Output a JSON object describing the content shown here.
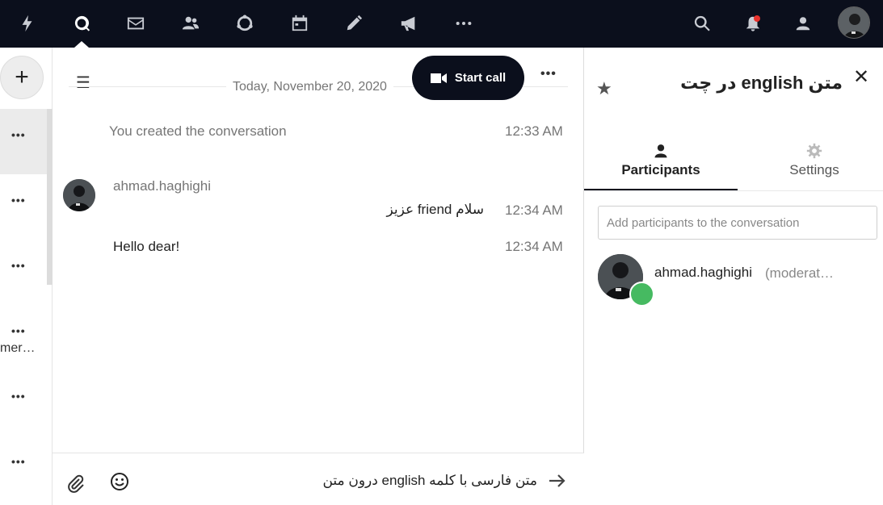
{
  "nav": {
    "icons": [
      "dashboard-icon",
      "talk-icon",
      "mail-icon",
      "contacts-icon",
      "circles-icon",
      "calendar-icon",
      "notes-icon",
      "announcements-icon",
      "more-apps-icon",
      "search-icon",
      "notifications-icon",
      "contacts-menu-icon",
      "user-avatar"
    ],
    "active": "talk-icon",
    "colors": {
      "bar": "#0b0f1c",
      "notification_dot": "#e9322d"
    }
  },
  "left": {
    "new_button_label": "+",
    "more_label": "•••",
    "truncated_item_text": "mer…"
  },
  "chat": {
    "date_separator": "Today, November 20, 2020",
    "start_call_label": "Start call",
    "more_label": "•••",
    "messages": [
      {
        "type": "system",
        "text": "You created the conversation",
        "time": "12:33 AM"
      },
      {
        "author": "ahmad.haghighi",
        "text": "سلام friend عزیز",
        "time": "12:34 AM"
      },
      {
        "author": "ahmad.haghighi",
        "text": "Hello dear!",
        "time": "12:34 AM"
      }
    ],
    "composer_value": "متن فارسی با کلمه english درون متن"
  },
  "sidebar": {
    "title": "متن english در چت",
    "tabs": [
      {
        "label": "Participants",
        "icon": "participants-icon",
        "active": true
      },
      {
        "label": "Settings",
        "icon": "settings-icon",
        "active": false
      }
    ],
    "add_placeholder": "Add participants to the conversation",
    "participants": [
      {
        "name": "ahmad.haghighi",
        "role": "(moderator)",
        "status_color": "#46ba61"
      }
    ]
  }
}
